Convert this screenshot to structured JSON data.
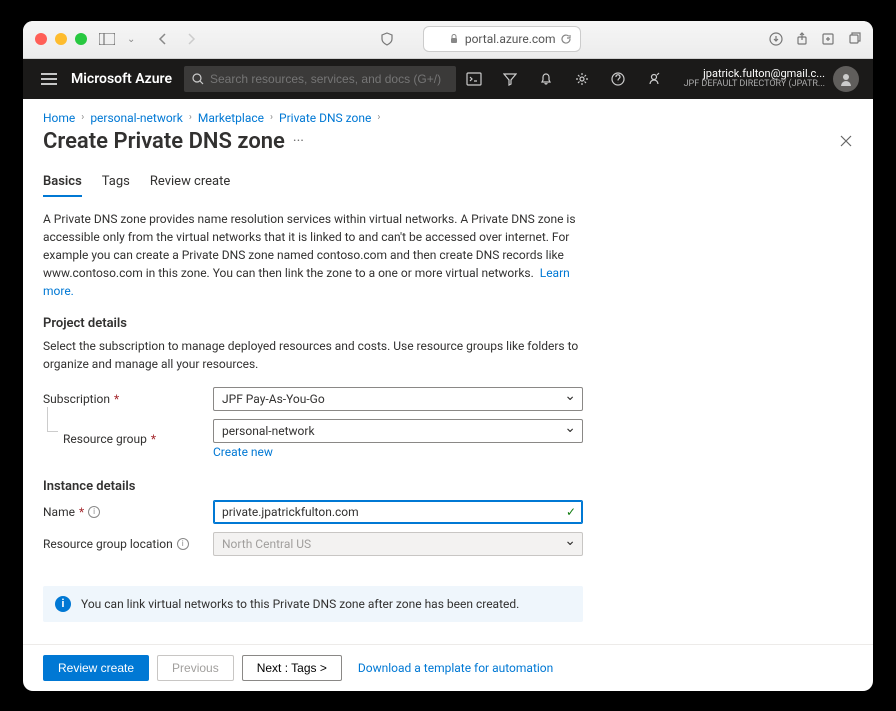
{
  "browser": {
    "url": "portal.azure.com"
  },
  "header": {
    "brand": "Microsoft Azure",
    "search_placeholder": "Search resources, services, and docs (G+/)",
    "user_email": "jpatrick.fulton@gmail.c...",
    "user_directory": "JPF DEFAULT DIRECTORY (JPATR..."
  },
  "breadcrumb": [
    "Home",
    "personal-network",
    "Marketplace",
    "Private DNS zone"
  ],
  "page": {
    "title": "Create Private DNS zone",
    "tabs": [
      "Basics",
      "Tags",
      "Review create"
    ],
    "active_tab": "Basics",
    "intro": "A Private DNS zone provides name resolution services within virtual networks. A Private DNS zone is accessible only from the virtual networks that it is linked to and can't be accessed over internet. For example you can create a Private DNS zone named contoso.com and then create DNS records like www.contoso.com in this zone. You can then link the zone to a one or more virtual networks.",
    "learn_more": "Learn more.",
    "project_details_title": "Project details",
    "project_details_desc": "Select the subscription to manage deployed resources and costs. Use resource groups like folders to organize and manage all your resources.",
    "subscription_label": "Subscription",
    "subscription_value": "JPF Pay-As-You-Go",
    "resource_group_label": "Resource group",
    "resource_group_value": "personal-network",
    "create_new": "Create new",
    "instance_details_title": "Instance details",
    "name_label": "Name",
    "name_value": "private.jpatrickfulton.com",
    "location_label": "Resource group location",
    "location_value": "North Central US",
    "info_message": "You can link virtual networks to this Private DNS zone after zone has been created."
  },
  "footer": {
    "review": "Review create",
    "previous": "Previous",
    "next": "Next : Tags >",
    "download": "Download a template for automation"
  }
}
